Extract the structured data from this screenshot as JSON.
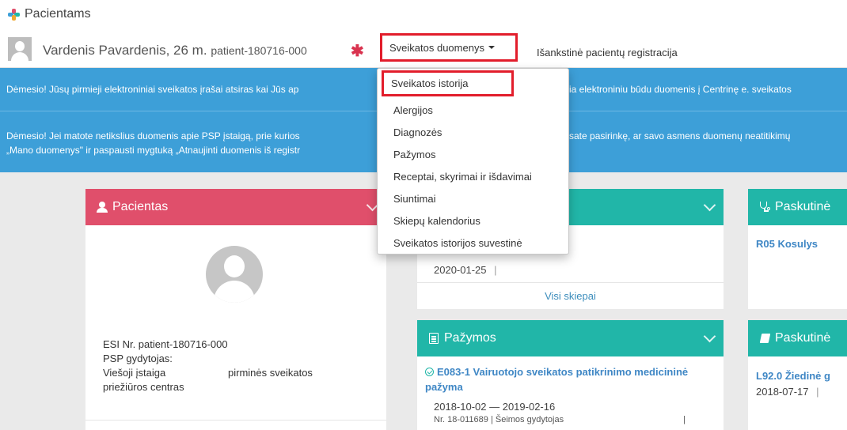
{
  "brand": {
    "title": "Pacientams"
  },
  "patient": {
    "name": "Vardenis Pavardenis, 26 m.",
    "id": "patient-180716-000"
  },
  "nav": {
    "dropdown_label": "Sveikatos duomenys",
    "link_label": "Išankstinė pacientų registracija"
  },
  "menu": {
    "items": [
      "Sveikatos istorija",
      "Alergijos",
      "Diagnozės",
      "Pažymos",
      "Receptai, skyrimai ir išdavimai",
      "Siuntimai",
      "Skiepų kalendorius",
      "Sveikatos istorijos suvestinė"
    ]
  },
  "alerts": {
    "a1_left": "Dėmesio! Jūsų pirmieji elektroniniai sveikatos įrašai atsiras kai Jūs ap",
    "a1_right": "ia elektroniniu būdu duomenis į Centrinę e. sveikatos",
    "a2_l1_left": "Dėmesio! Jei matote netikslius duomenis apie PSP įstaigą, prie kurios",
    "a2_l1_right": "sate pasirinkę, ar savo asmens duomenų neatitikimų",
    "a2_l2_left": "„Mano duomenys\" ir paspausti mygtuką „Atnaujinti duomenis iš registr"
  },
  "pacientas_card": {
    "title": "Pacientas",
    "esi": "ESI Nr. patient-180716-000",
    "psp_label": "PSP gydytojas:",
    "institution_left": "Viešoji įstaiga",
    "institution_right": "pirminės sveikatos",
    "institution_line2": "priežiūros centras"
  },
  "skiepai_card": {
    "date": "2020-01-25",
    "sep": "|",
    "all_link": "Visi skiepai"
  },
  "pazymos_card": {
    "title": "Pažymos",
    "item_title": "E083-1 Vairuotojo sveikatos patikrinimo medicininė pažyma",
    "item_dates": "2018-10-02 — 2019-02-16",
    "item_meta": "Nr. 18-011689  |  Šeimos gydytojas",
    "item_meta_sep": "|"
  },
  "diagnozes_card": {
    "title": "Paskutinė",
    "item": "R05 Kosulys"
  },
  "ligos_card": {
    "title": "Paskutinė",
    "item": "L92.0 Žiedinė g",
    "date": "2018-07-17",
    "sep": "|"
  },
  "colors": {
    "accent_red": "#e21d2b",
    "teal": "#21b6a8",
    "pink": "#e04f6b",
    "alert_blue": "#3d9fd8",
    "link_blue": "#3f87c5"
  }
}
